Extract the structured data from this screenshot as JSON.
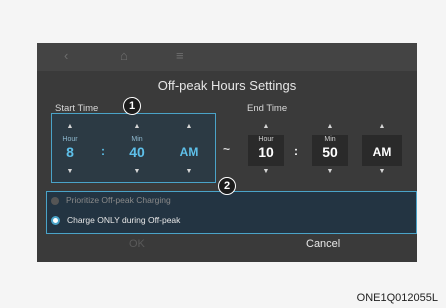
{
  "topbar": {
    "back_icon": "‹",
    "home_icon": "⌂",
    "menu_icon": "≡"
  },
  "title": "Off-peak Hours Settings",
  "start": {
    "label": "Start Time",
    "hour_label": "Hour",
    "hour": "8",
    "min_label": "Min",
    "min": "40",
    "ampm": "AM"
  },
  "end": {
    "label": "End Time",
    "hour_label": "Hour",
    "hour": "10",
    "min_label": "Min",
    "min": "50",
    "ampm": "AM"
  },
  "separator": ":",
  "tilde": "~",
  "options": [
    {
      "label": "Prioritize Off-peak Charging",
      "selected": false
    },
    {
      "label": "Charge ONLY during Off-peak",
      "selected": true
    }
  ],
  "buttons": {
    "ok": "OK",
    "cancel": "Cancel"
  },
  "callouts": {
    "one": "1",
    "two": "2"
  },
  "caption": "ONE1Q012055L",
  "colors": {
    "accent": "#4aa3c8",
    "highlight_text": "#5ec0ea",
    "screen_bg": "#3a3a3a"
  },
  "arrows": {
    "up": "▲",
    "down": "▼"
  }
}
